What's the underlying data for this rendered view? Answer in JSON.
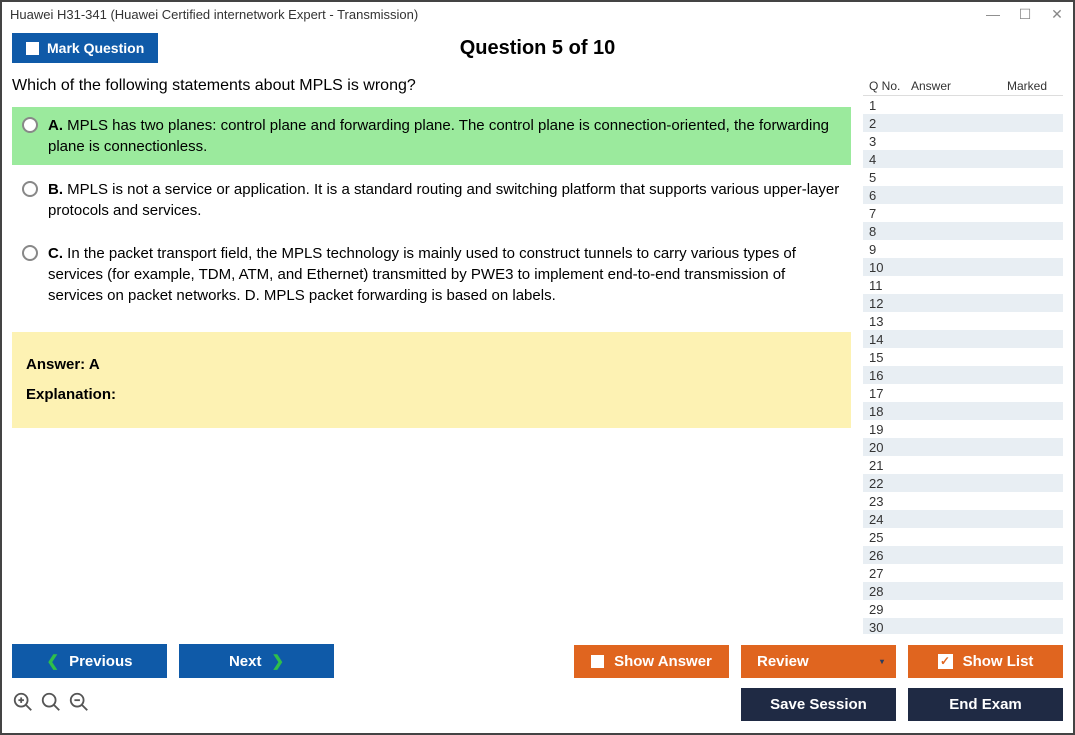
{
  "window_title": "Huawei H31-341 (Huawei Certified internetwork Expert - Transmission)",
  "header": {
    "mark_label": "Mark Question",
    "counter": "Question 5 of 10"
  },
  "question": "Which of the following statements about MPLS is wrong?",
  "options": [
    {
      "letter": "A.",
      "text": "MPLS has two planes: control plane and forwarding plane. The control plane is connection-oriented, the forwarding plane is connectionless.",
      "highlight": true
    },
    {
      "letter": "B.",
      "text": "MPLS is not a service or application. It is a standard routing and switching platform that supports various upper-layer protocols and services.",
      "highlight": false
    },
    {
      "letter": "C.",
      "text": "In the packet transport field, the MPLS technology is mainly used to construct tunnels to carry various types of services (for example, TDM, ATM, and Ethernet) transmitted by PWE3 to implement end-to-end transmission of services on packet networks. D. MPLS packet forwarding is based on labels.",
      "highlight": false
    }
  ],
  "answer_panel": {
    "answer_label": "Answer:",
    "answer_value": "A",
    "explanation_label": "Explanation:"
  },
  "sidebar": {
    "cols": {
      "qno": "Q No.",
      "answer": "Answer",
      "marked": "Marked"
    },
    "row_count": 30
  },
  "footer": {
    "previous": "Previous",
    "next": "Next",
    "show_answer": "Show Answer",
    "review": "Review",
    "show_list": "Show List",
    "save_session": "Save Session",
    "end_exam": "End Exam"
  }
}
